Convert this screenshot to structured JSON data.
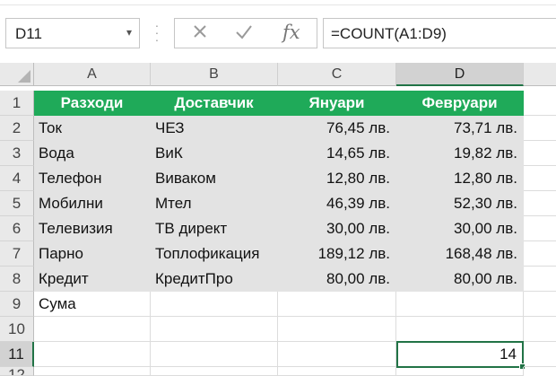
{
  "name_box": {
    "value": "D11"
  },
  "formula_bar": {
    "formula": "=COUNT(A1:D9)",
    "cancel_icon": "close-icon",
    "enter_icon": "check-icon",
    "fx_icon": "fx-icon"
  },
  "columns": [
    "A",
    "B",
    "C",
    "D"
  ],
  "rows": [
    "1",
    "2",
    "3",
    "4",
    "5",
    "6",
    "7",
    "8",
    "9",
    "10",
    "11",
    "12"
  ],
  "table": {
    "headers": [
      "Разходи",
      "Доставчик",
      "Януари",
      "Февруари"
    ],
    "rows": [
      [
        "Ток",
        "ЧЕЗ",
        "76,45 лв.",
        "73,71 лв."
      ],
      [
        "Вода",
        "ВиК",
        "14,65 лв.",
        "19,82 лв."
      ],
      [
        "Телефон",
        "Виваком",
        "12,80 лв.",
        "12,80 лв."
      ],
      [
        "Мобилни",
        "Мтел",
        "46,39 лв.",
        "52,30 лв."
      ],
      [
        "Телевизия",
        "ТВ директ",
        "30,00 лв.",
        "30,00 лв."
      ],
      [
        "Парно",
        "Топлофикация",
        "189,12 лв.",
        "168,48 лв."
      ],
      [
        "Кредит",
        "КредитПро",
        "80,00 лв.",
        "80,00 лв."
      ]
    ],
    "sum_label": "Сума"
  },
  "active_cell": {
    "ref": "D11",
    "value": "14"
  },
  "colors": {
    "header_green": "#1faa59",
    "selection_green": "#217346",
    "data_gray": "#e3e3e3"
  }
}
